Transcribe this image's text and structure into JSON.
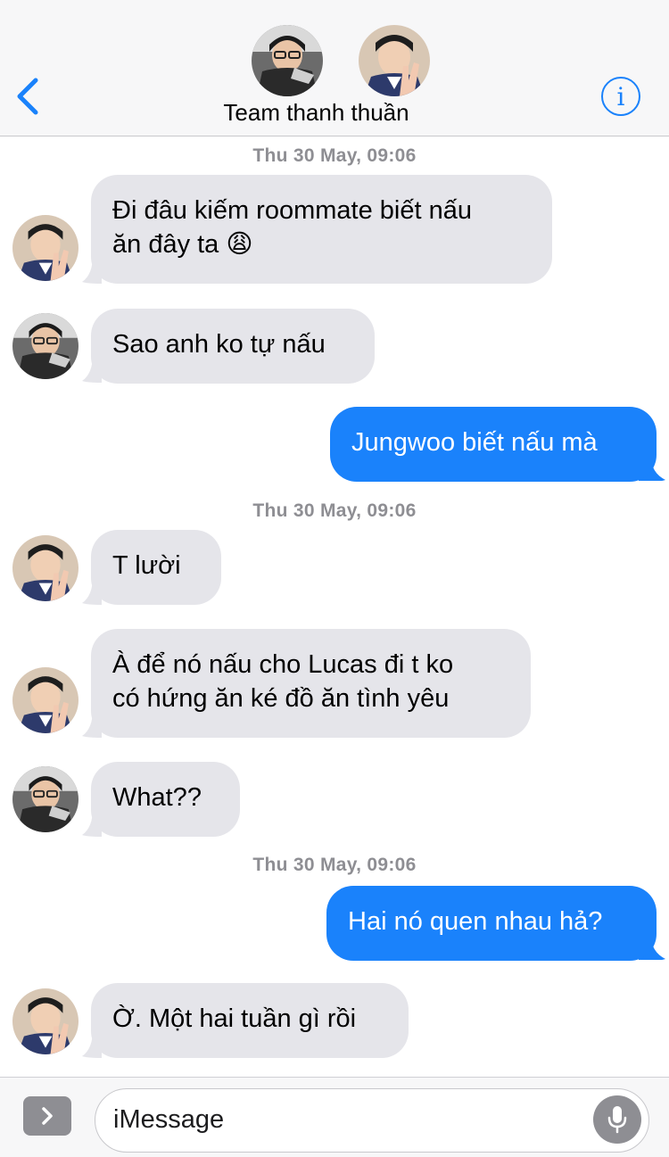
{
  "header": {
    "title": "Team thanh thuần",
    "back_icon": "chevron-left-icon",
    "info_icon": "info-icon",
    "info_glyph": "i",
    "accent_color": "#1a82fb"
  },
  "timestamps": [
    "Thu 30 May, 09:06",
    "Thu 30 May, 09:06",
    "Thu 30 May, 09:06"
  ],
  "messages": [
    {
      "direction": "incoming",
      "sender": "B",
      "lines": [
        "Đi đâu kiếm roommate biết nấu",
        "ăn đây ta 😩"
      ]
    },
    {
      "direction": "incoming",
      "sender": "A",
      "lines": [
        "Sao anh ko tự nấu"
      ]
    },
    {
      "direction": "outgoing",
      "lines": [
        "Jungwoo biết nấu mà"
      ]
    },
    {
      "direction": "incoming",
      "sender": "B",
      "lines": [
        "T lười"
      ]
    },
    {
      "direction": "incoming",
      "sender": "B",
      "lines": [
        "À để nó nấu cho Lucas đi t ko",
        "có hứng ăn ké đồ ăn tình yêu"
      ]
    },
    {
      "direction": "incoming",
      "sender": "A",
      "lines": [
        "What??"
      ]
    },
    {
      "direction": "outgoing",
      "lines": [
        "Hai nó quen nhau hả?"
      ]
    },
    {
      "direction": "incoming",
      "sender": "B",
      "lines": [
        "Ờ. Một hai tuần gì rồi"
      ]
    }
  ],
  "composer": {
    "placeholder": "iMessage",
    "apps_icon": "chevron-right-icon",
    "mic_icon": "microphone-icon"
  },
  "colors": {
    "incoming_bubble": "#e5e5ea",
    "outgoing_bubble": "#1a82fb",
    "timestamp": "#8e8e93"
  }
}
